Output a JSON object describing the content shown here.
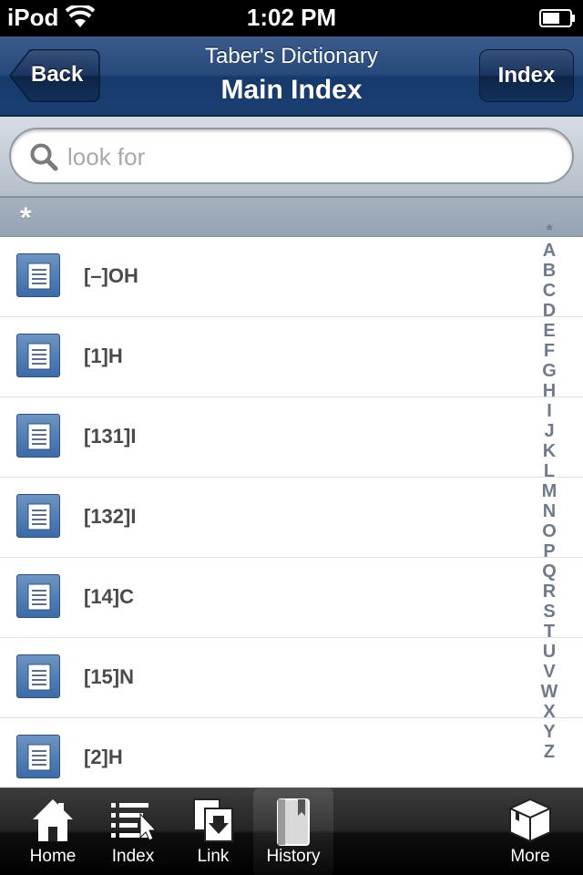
{
  "status_bar": {
    "carrier": "iPod",
    "time": "1:02 PM"
  },
  "nav": {
    "back_label": "Back",
    "subtitle": "Taber's Dictionary",
    "title": "Main Index",
    "index_label": "Index"
  },
  "search": {
    "placeholder": "look for",
    "value": ""
  },
  "section": {
    "header": "*"
  },
  "entries": [
    "[–]OH",
    "[1]H",
    "[131]I",
    "[132]I",
    "[14]C",
    "[15]N",
    "[2]H"
  ],
  "index_rail": [
    "*",
    "A",
    "B",
    "C",
    "D",
    "E",
    "F",
    "G",
    "H",
    "I",
    "J",
    "K",
    "L",
    "M",
    "N",
    "O",
    "P",
    "Q",
    "R",
    "S",
    "T",
    "U",
    "V",
    "W",
    "X",
    "Y",
    "Z"
  ],
  "tabs": [
    {
      "label": "Home",
      "icon": "home-icon"
    },
    {
      "label": "Index",
      "icon": "index-list-icon"
    },
    {
      "label": "Link",
      "icon": "link-icon"
    },
    {
      "label": "History",
      "icon": "history-book-icon"
    },
    {
      "label": "More",
      "icon": "more-box-icon"
    }
  ],
  "colors": {
    "nav_blue": "#264a7c",
    "doc_icon_blue": "#4f7cb4",
    "index_rail": "#6f7b8b",
    "tab_bar": "#1a1a1a"
  }
}
